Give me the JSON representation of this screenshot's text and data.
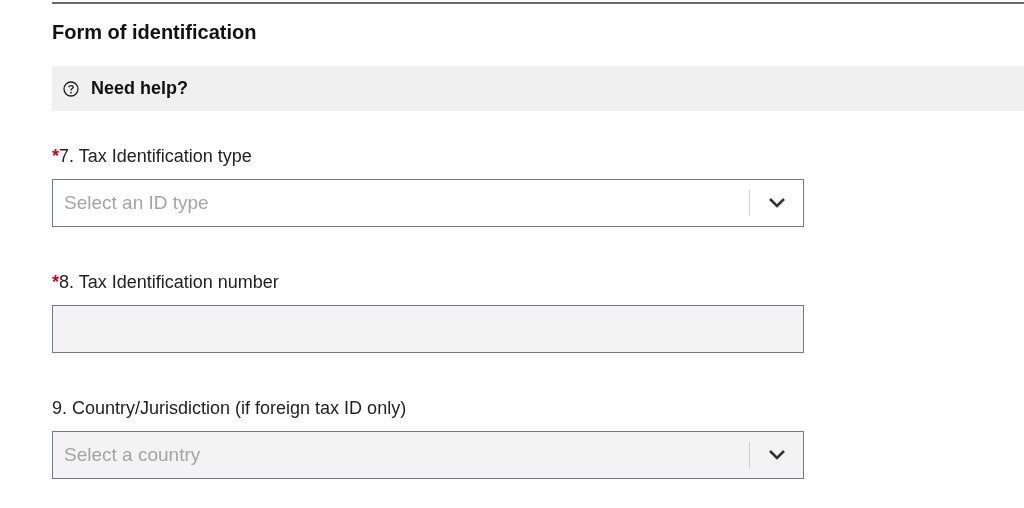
{
  "section": {
    "title": "Form of identification"
  },
  "help": {
    "label": "Need help?"
  },
  "fields": [
    {
      "kind": "select",
      "required_mark": "*",
      "label": "7. Tax Identification type",
      "placeholder": "Select an ID type",
      "disabled": false
    },
    {
      "kind": "text",
      "required_mark": "*",
      "label": "8. Tax Identification number",
      "disabled": true
    },
    {
      "kind": "select",
      "label": "9. Country/Jurisdiction (if foreign tax ID only)",
      "placeholder": "Select a country",
      "disabled": true
    }
  ]
}
